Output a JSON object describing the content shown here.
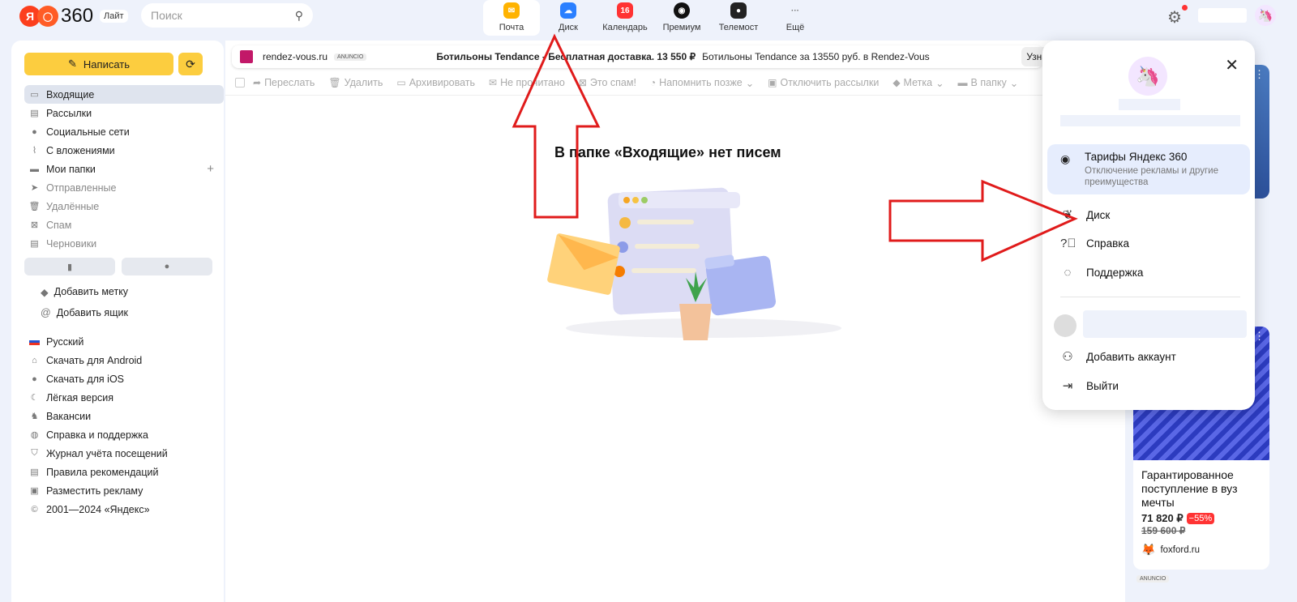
{
  "header": {
    "logo_ya": "Я",
    "logo_num": "360",
    "lite": "Лайт",
    "search_placeholder": "Поиск",
    "apps": [
      {
        "label": "Почта",
        "icon": "mail-app-icon",
        "color": "#ffb300",
        "badge": ""
      },
      {
        "label": "Диск",
        "icon": "disk-app-icon",
        "color": "#2a7fff",
        "badge": ""
      },
      {
        "label": "Календарь",
        "icon": "calendar-app-icon",
        "color": "#f33",
        "badge": "16"
      },
      {
        "label": "Премиум",
        "icon": "premium-app-icon",
        "color": "#111",
        "badge": ""
      },
      {
        "label": "Телемост",
        "icon": "telemost-app-icon",
        "color": "#222",
        "badge": ""
      },
      {
        "label": "Ещё",
        "icon": "more-app-icon",
        "color": "#fff",
        "badge": "···"
      }
    ]
  },
  "sidebar": {
    "compose": "Написать",
    "folders": [
      {
        "label": "Входящие",
        "icon": "inbox-icon",
        "selected": true
      },
      {
        "label": "Рассылки",
        "icon": "newsletters-icon"
      },
      {
        "label": "Социальные сети",
        "icon": "social-icon"
      },
      {
        "label": "С вложениями",
        "icon": "attachment-icon"
      },
      {
        "label": "Мои папки",
        "icon": "folder-icon"
      },
      {
        "label": "Отправленные",
        "icon": "sent-icon",
        "dim": true
      },
      {
        "label": "Удалённые",
        "icon": "trash-icon",
        "dim": true
      },
      {
        "label": "Спам",
        "icon": "spam-icon",
        "dim": true
      },
      {
        "label": "Черновики",
        "icon": "drafts-icon",
        "dim": true
      }
    ],
    "add_label": "Добавить метку",
    "add_box": "Добавить ящик",
    "bottom": [
      {
        "label": "Русский",
        "icon": "flag-ru-icon"
      },
      {
        "label": "Скачать для Android",
        "icon": "android-icon"
      },
      {
        "label": "Скачать для iOS",
        "icon": "apple-icon"
      },
      {
        "label": "Лёгкая версия",
        "icon": "moon-icon"
      },
      {
        "label": "Вакансии",
        "icon": "jobs-icon"
      },
      {
        "label": "Справка и поддержка",
        "icon": "help-icon"
      },
      {
        "label": "Журнал учёта посещений",
        "icon": "shield-icon"
      },
      {
        "label": "Правила рекомендаций",
        "icon": "rules-icon"
      },
      {
        "label": "Разместить рекламу",
        "icon": "ads-icon"
      },
      {
        "label": "2001—2024 «Яндекс»",
        "icon": "copyright-icon"
      }
    ]
  },
  "main": {
    "ad": {
      "domain": "rendez-vous.ru",
      "anuncio": "ANUNCIO",
      "title": "Ботильоны Tendance - Бесплатная доставка. 13 550 ₽",
      "text": "Ботильоны Tendance за 13550 руб. в Rendez-Vous",
      "more": "Узна"
    },
    "toolbar": [
      "Переслать",
      "Удалить",
      "Архивировать",
      "Не прочитано",
      "Это спам!",
      "Напомнить позже",
      "Отключить рассылки",
      "Метка",
      "В папку"
    ],
    "empty": "В папке «Входящие» нет писем"
  },
  "right_ad": {
    "title": "Гарантированное поступление в вуз мечты",
    "price": "71 820 ₽",
    "discount": "−55%",
    "old_price": "159 600 ₽",
    "site": "foxford.ru",
    "anuncio": "ANUNCIO"
  },
  "popup": {
    "tariff_title": "Тарифы Яндекс 360",
    "tariff_sub": "Отключение рекламы и другие преимущества",
    "disk": "Диск",
    "help": "Справка",
    "support": "Поддержка",
    "add_account": "Добавить аккаунт",
    "logout": "Выйти"
  }
}
